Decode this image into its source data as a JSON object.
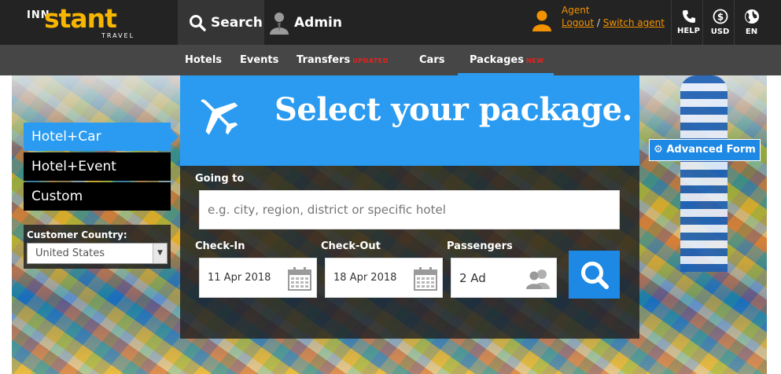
{
  "brand": {
    "inn": "INN",
    "stant": "stant",
    "travel": "TRAVEL"
  },
  "header": {
    "search_label": "Search",
    "admin_label": "Admin",
    "agent_title": "Agent",
    "logout_label": "Logout",
    "separator": " / ",
    "switch_agent_label": "Switch agent",
    "help_label": "HELP",
    "currency_label": "USD",
    "language_label": "EN"
  },
  "nav": {
    "items": [
      {
        "label": "Hotels",
        "badge": ""
      },
      {
        "label": "Events",
        "badge": ""
      },
      {
        "label": "Transfers",
        "badge": "UPDATED"
      },
      {
        "label": "Cars",
        "badge": ""
      },
      {
        "label": "Packages",
        "badge": "NEW"
      }
    ]
  },
  "sidebar": {
    "tabs": [
      {
        "label": "Hotel+Car"
      },
      {
        "label": "Hotel+Event"
      },
      {
        "label": "Custom"
      }
    ],
    "country_label": "Customer Country:",
    "country_value": "United States"
  },
  "advanced_form_label": "Advanced Form",
  "panel": {
    "title": "Select your package.",
    "going_to_label": "Going to",
    "going_to_placeholder": "e.g. city, region, district or specific hotel",
    "checkin_label": "Check-In",
    "checkin_value": "11 Apr 2018",
    "checkout_label": "Check-Out",
    "checkout_value": "18 Apr 2018",
    "passengers_label": "Passengers",
    "passengers_value": "2 Ad"
  },
  "colors": {
    "accent_blue": "#2a9bf0",
    "brand_yellow": "#f7b600",
    "agent_orange": "#f39200",
    "badge_red": "#e8231b"
  }
}
